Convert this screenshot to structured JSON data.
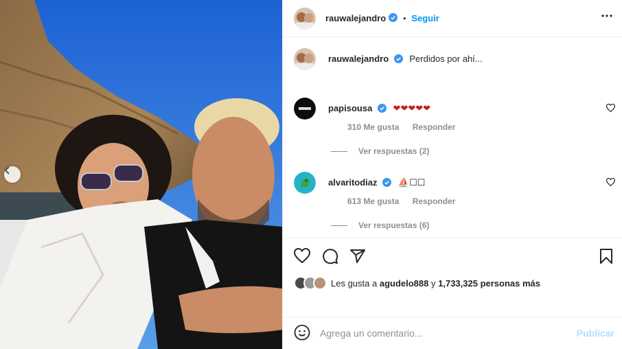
{
  "post": {
    "author": "rauwalejandro",
    "follow_label": "Seguir",
    "separator": "•",
    "caption": "Perdidos por ahí..."
  },
  "comments": [
    {
      "username": "papisousa",
      "text": "❤❤❤❤❤",
      "likes": "310 Me gusta",
      "reply_label": "Responder",
      "view_replies": "Ver respuestas (2)"
    },
    {
      "username": "alvaritodiaz",
      "text": "⛵☐☐",
      "likes": "613 Me gusta",
      "reply_label": "Responder",
      "view_replies": "Ver respuestas (6)"
    }
  ],
  "likes_summary": {
    "prefix": "Les gusta a",
    "first_user": "agudelo888",
    "middle": "y",
    "count_text": "1,733,325 personas más"
  },
  "add_comment": {
    "placeholder": "Agrega un comentario...",
    "publish_label": "Publicar"
  },
  "colors": {
    "accent": "#0095f6",
    "verified": "#3897f0",
    "heart_red": "#c0231f",
    "publish_disabled": "#b2dffc"
  },
  "icons": [
    "chevron-left-icon",
    "verified-badge-icon",
    "more-options-icon",
    "heart-icon",
    "comment-icon",
    "share-icon",
    "bookmark-icon",
    "emoji-icon"
  ]
}
